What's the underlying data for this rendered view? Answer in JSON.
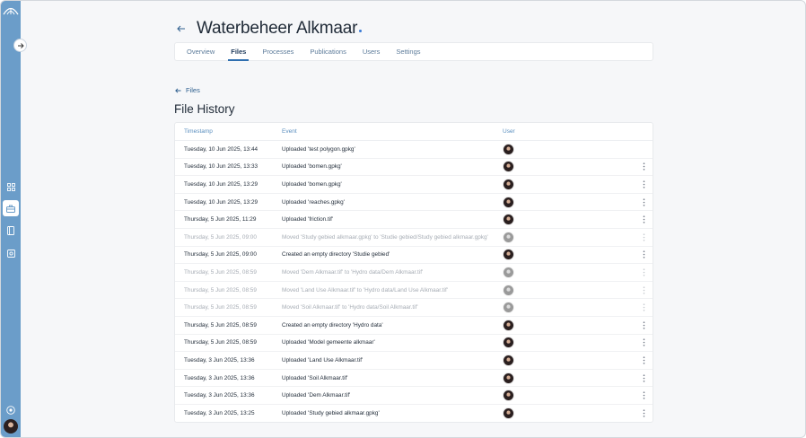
{
  "project": {
    "title": "Waterbeheer Alkmaar"
  },
  "tabs": [
    {
      "label": "Overview",
      "active": false
    },
    {
      "label": "Files",
      "active": true
    },
    {
      "label": "Processes",
      "active": false
    },
    {
      "label": "Publications",
      "active": false
    },
    {
      "label": "Users",
      "active": false
    },
    {
      "label": "Settings",
      "active": false
    }
  ],
  "breadcrumb": {
    "label": "Files"
  },
  "section": {
    "title": "File History"
  },
  "table": {
    "headers": {
      "timestamp": "Timestamp",
      "event": "Event",
      "user": "User"
    },
    "rows": [
      {
        "timestamp": "Tuesday, 10 Jun 2025, 13:44",
        "event": "Uploaded 'test polygon.gpkg'",
        "faded": false,
        "menu": false
      },
      {
        "timestamp": "Tuesday, 10 Jun 2025, 13:33",
        "event": "Uploaded 'bomen.gpkg'",
        "faded": false,
        "menu": true
      },
      {
        "timestamp": "Tuesday, 10 Jun 2025, 13:29",
        "event": "Uploaded 'bomen.gpkg'",
        "faded": false,
        "menu": true
      },
      {
        "timestamp": "Tuesday, 10 Jun 2025, 13:29",
        "event": "Uploaded 'reaches.gpkg'",
        "faded": false,
        "menu": true
      },
      {
        "timestamp": "Thursday, 5 Jun 2025, 11:29",
        "event": "Uploaded 'friction.tif'",
        "faded": false,
        "menu": true
      },
      {
        "timestamp": "Thursday, 5 Jun 2025, 09:00",
        "event": "Moved 'Study gebied alkmaar.gpkg' to 'Studie gebied/Study gebied alkmaar.gpkg'",
        "faded": true,
        "menu": true
      },
      {
        "timestamp": "Thursday, 5 Jun 2025, 09:00",
        "event": "Created an empty directory 'Studie gebied'",
        "faded": false,
        "menu": true
      },
      {
        "timestamp": "Thursday, 5 Jun 2025, 08:59",
        "event": "Moved 'Dem Alkmaar.tif' to 'Hydro data/Dem Alkmaar.tif'",
        "faded": true,
        "menu": true
      },
      {
        "timestamp": "Thursday, 5 Jun 2025, 08:59",
        "event": "Moved 'Land Use Alkmaar.tif' to 'Hydro data/Land Use Alkmaar.tif'",
        "faded": true,
        "menu": true
      },
      {
        "timestamp": "Thursday, 5 Jun 2025, 08:59",
        "event": "Moved 'Soil Alkmaar.tif' to 'Hydro data/Soil Alkmaar.tif'",
        "faded": true,
        "menu": true
      },
      {
        "timestamp": "Thursday, 5 Jun 2025, 08:59",
        "event": "Created an empty directory 'Hydro data'",
        "faded": false,
        "menu": true
      },
      {
        "timestamp": "Thursday, 5 Jun 2025, 08:59",
        "event": "Uploaded 'Model gemeente alkmaar'",
        "faded": false,
        "menu": true
      },
      {
        "timestamp": "Tuesday, 3 Jun 2025, 13:36",
        "event": "Uploaded 'Land Use Alkmaar.tif'",
        "faded": false,
        "menu": true
      },
      {
        "timestamp": "Tuesday, 3 Jun 2025, 13:36",
        "event": "Uploaded 'Soil Alkmaar.tif'",
        "faded": false,
        "menu": true
      },
      {
        "timestamp": "Tuesday, 3 Jun 2025, 13:36",
        "event": "Uploaded 'Dem Alkmaar.tif'",
        "faded": false,
        "menu": true
      },
      {
        "timestamp": "Tuesday, 3 Jun 2025, 13:25",
        "event": "Uploaded 'Study gebied alkmaar.gpkg'",
        "faded": false,
        "menu": true
      }
    ]
  },
  "colors": {
    "sidebar": "#6b9dc9",
    "accent": "#2f6fb0",
    "title_dot": "#3a7bd5"
  },
  "icons": {
    "sidebar": [
      "umbrella-logo-icon",
      "expand-arrow-icon",
      "grid-icon",
      "briefcase-icon",
      "book-icon",
      "settings-square-icon",
      "add-circle-icon"
    ],
    "row": [
      "user-avatar",
      "more-vertical-icon"
    ]
  }
}
